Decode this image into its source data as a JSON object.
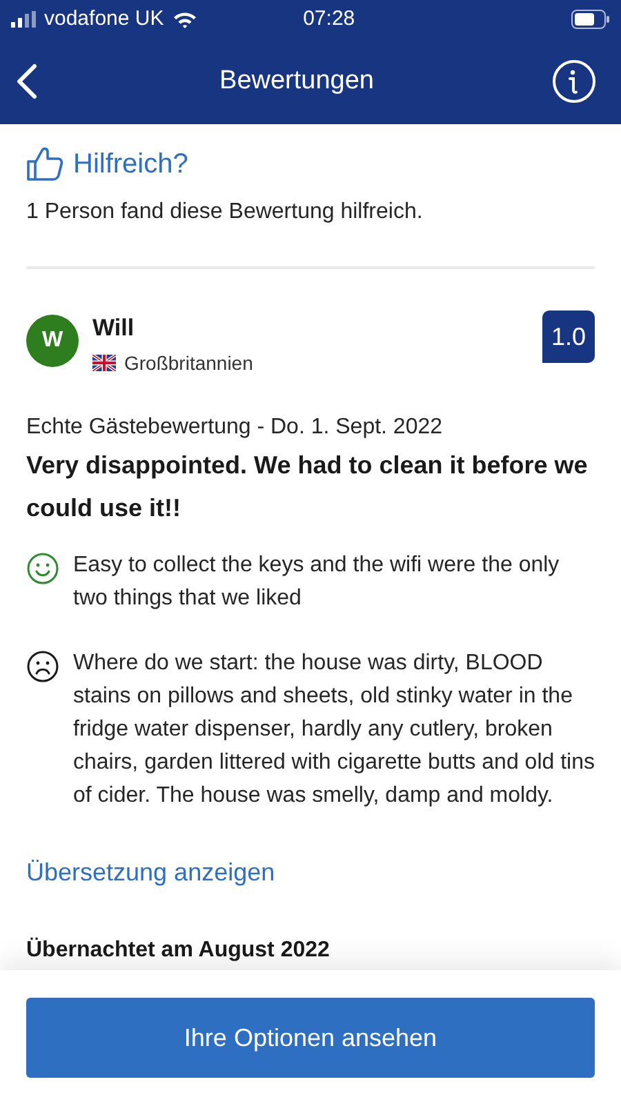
{
  "status_bar": {
    "carrier": "vodafone UK",
    "time": "07:28"
  },
  "nav": {
    "title": "Bewertungen"
  },
  "helpful": {
    "label": "Hilfreich?",
    "text": "1 Person fand diese Bewertung hilfreich."
  },
  "review": {
    "avatar_letter": "W",
    "name": "Will",
    "country": "Großbritannien",
    "score": "1.0",
    "meta": "Echte Gästebewertung - Do. 1. Sept. 2022",
    "title": "Very disappointed. We had to clean it before we could use it!!",
    "points": [
      {
        "kind": "positive",
        "text": "Easy to collect the keys and the wifi were the only two things that we liked"
      },
      {
        "kind": "negative",
        "text": "Where do we start: the house was dirty, BLOOD stains on pillows and sheets, old stinky water in the fridge water dispenser, hardly any cutlery, broken chairs, garden littered with cigarette butts and old tins of cider. The house was smelly, damp and moldy."
      }
    ],
    "translate_link": "Übersetzung anzeigen",
    "stayed": "Übernachtet am August 2022"
  },
  "footer": {
    "button": "Ihre Optionen ansehen"
  }
}
